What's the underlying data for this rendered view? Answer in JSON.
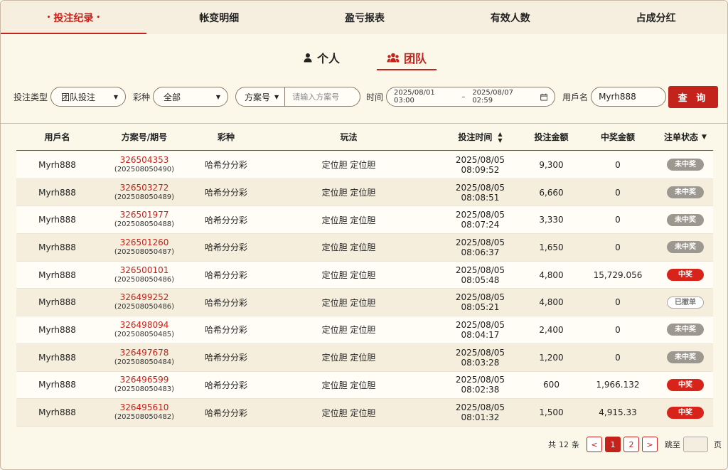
{
  "top_tabs": [
    {
      "label": "投注纪录",
      "active": true
    },
    {
      "label": "帐变明细"
    },
    {
      "label": "盈亏报表"
    },
    {
      "label": "有效人数"
    },
    {
      "label": "占成分红"
    }
  ],
  "sub_tabs": [
    {
      "label": "个人",
      "icon": "person-icon"
    },
    {
      "label": "团队",
      "icon": "team-icon",
      "active": true
    }
  ],
  "filters": {
    "bet_type_label": "投注类型",
    "bet_type_value": "团队投注",
    "lottery_label": "彩种",
    "lottery_value": "全部",
    "plan_select": "方案号",
    "plan_placeholder": "请输入方案号",
    "time_label": "时间",
    "date_start": "2025/08/01 03:00",
    "date_sep": "–",
    "date_end": "2025/08/07 02:59",
    "user_label": "用戶名",
    "user_value": "Myrh888",
    "query_button": "查 询"
  },
  "table": {
    "headers": [
      "用戶名",
      "方案号/期号",
      "彩种",
      "玩法",
      "投注时间",
      "投注金额",
      "中奖金额",
      "注单状态"
    ],
    "rows": [
      {
        "user": "Myrh888",
        "ticket": "326504353",
        "issue": "(202508050490)",
        "lottery": "哈希分分彩",
        "play": "定位胆 定位胆",
        "time": "2025/08/05 08:09:52",
        "amount": "9,300",
        "win": "0",
        "status": "未中奖",
        "status_type": "lose"
      },
      {
        "user": "Myrh888",
        "ticket": "326503272",
        "issue": "(202508050489)",
        "lottery": "哈希分分彩",
        "play": "定位胆 定位胆",
        "time": "2025/08/05 08:08:51",
        "amount": "6,660",
        "win": "0",
        "status": "未中奖",
        "status_type": "lose"
      },
      {
        "user": "Myrh888",
        "ticket": "326501977",
        "issue": "(202508050488)",
        "lottery": "哈希分分彩",
        "play": "定位胆 定位胆",
        "time": "2025/08/05 08:07:24",
        "amount": "3,330",
        "win": "0",
        "status": "未中奖",
        "status_type": "lose"
      },
      {
        "user": "Myrh888",
        "ticket": "326501260",
        "issue": "(202508050487)",
        "lottery": "哈希分分彩",
        "play": "定位胆 定位胆",
        "time": "2025/08/05 08:06:37",
        "amount": "1,650",
        "win": "0",
        "status": "未中奖",
        "status_type": "lose"
      },
      {
        "user": "Myrh888",
        "ticket": "326500101",
        "issue": "(202508050486)",
        "lottery": "哈希分分彩",
        "play": "定位胆 定位胆",
        "time": "2025/08/05 08:05:48",
        "amount": "4,800",
        "win": "15,729.056",
        "status": "中奖",
        "status_type": "win"
      },
      {
        "user": "Myrh888",
        "ticket": "326499252",
        "issue": "(202508050486)",
        "lottery": "哈希分分彩",
        "play": "定位胆 定位胆",
        "time": "2025/08/05 08:05:21",
        "amount": "4,800",
        "win": "0",
        "status": "已撤单",
        "status_type": "cancel"
      },
      {
        "user": "Myrh888",
        "ticket": "326498094",
        "issue": "(202508050485)",
        "lottery": "哈希分分彩",
        "play": "定位胆 定位胆",
        "time": "2025/08/05 08:04:17",
        "amount": "2,400",
        "win": "0",
        "status": "未中奖",
        "status_type": "lose"
      },
      {
        "user": "Myrh888",
        "ticket": "326497678",
        "issue": "(202508050484)",
        "lottery": "哈希分分彩",
        "play": "定位胆 定位胆",
        "time": "2025/08/05 08:03:28",
        "amount": "1,200",
        "win": "0",
        "status": "未中奖",
        "status_type": "lose"
      },
      {
        "user": "Myrh888",
        "ticket": "326496599",
        "issue": "(202508050483)",
        "lottery": "哈希分分彩",
        "play": "定位胆 定位胆",
        "time": "2025/08/05 08:02:38",
        "amount": "600",
        "win": "1,966.132",
        "status": "中奖",
        "status_type": "win"
      },
      {
        "user": "Myrh888",
        "ticket": "326495610",
        "issue": "(202508050482)",
        "lottery": "哈希分分彩",
        "play": "定位胆 定位胆",
        "time": "2025/08/05 08:01:32",
        "amount": "1,500",
        "win": "4,915.33",
        "status": "中奖",
        "status_type": "win"
      }
    ]
  },
  "pagination": {
    "total_prefix": "共",
    "total_count": "12",
    "total_suffix": "条",
    "prev": "<",
    "pages": [
      "1",
      "2"
    ],
    "next": ">",
    "jump_label": "跳至",
    "page_suffix": "页"
  },
  "colors": {
    "accent": "#c4231b",
    "background": "#fbf8ea"
  }
}
